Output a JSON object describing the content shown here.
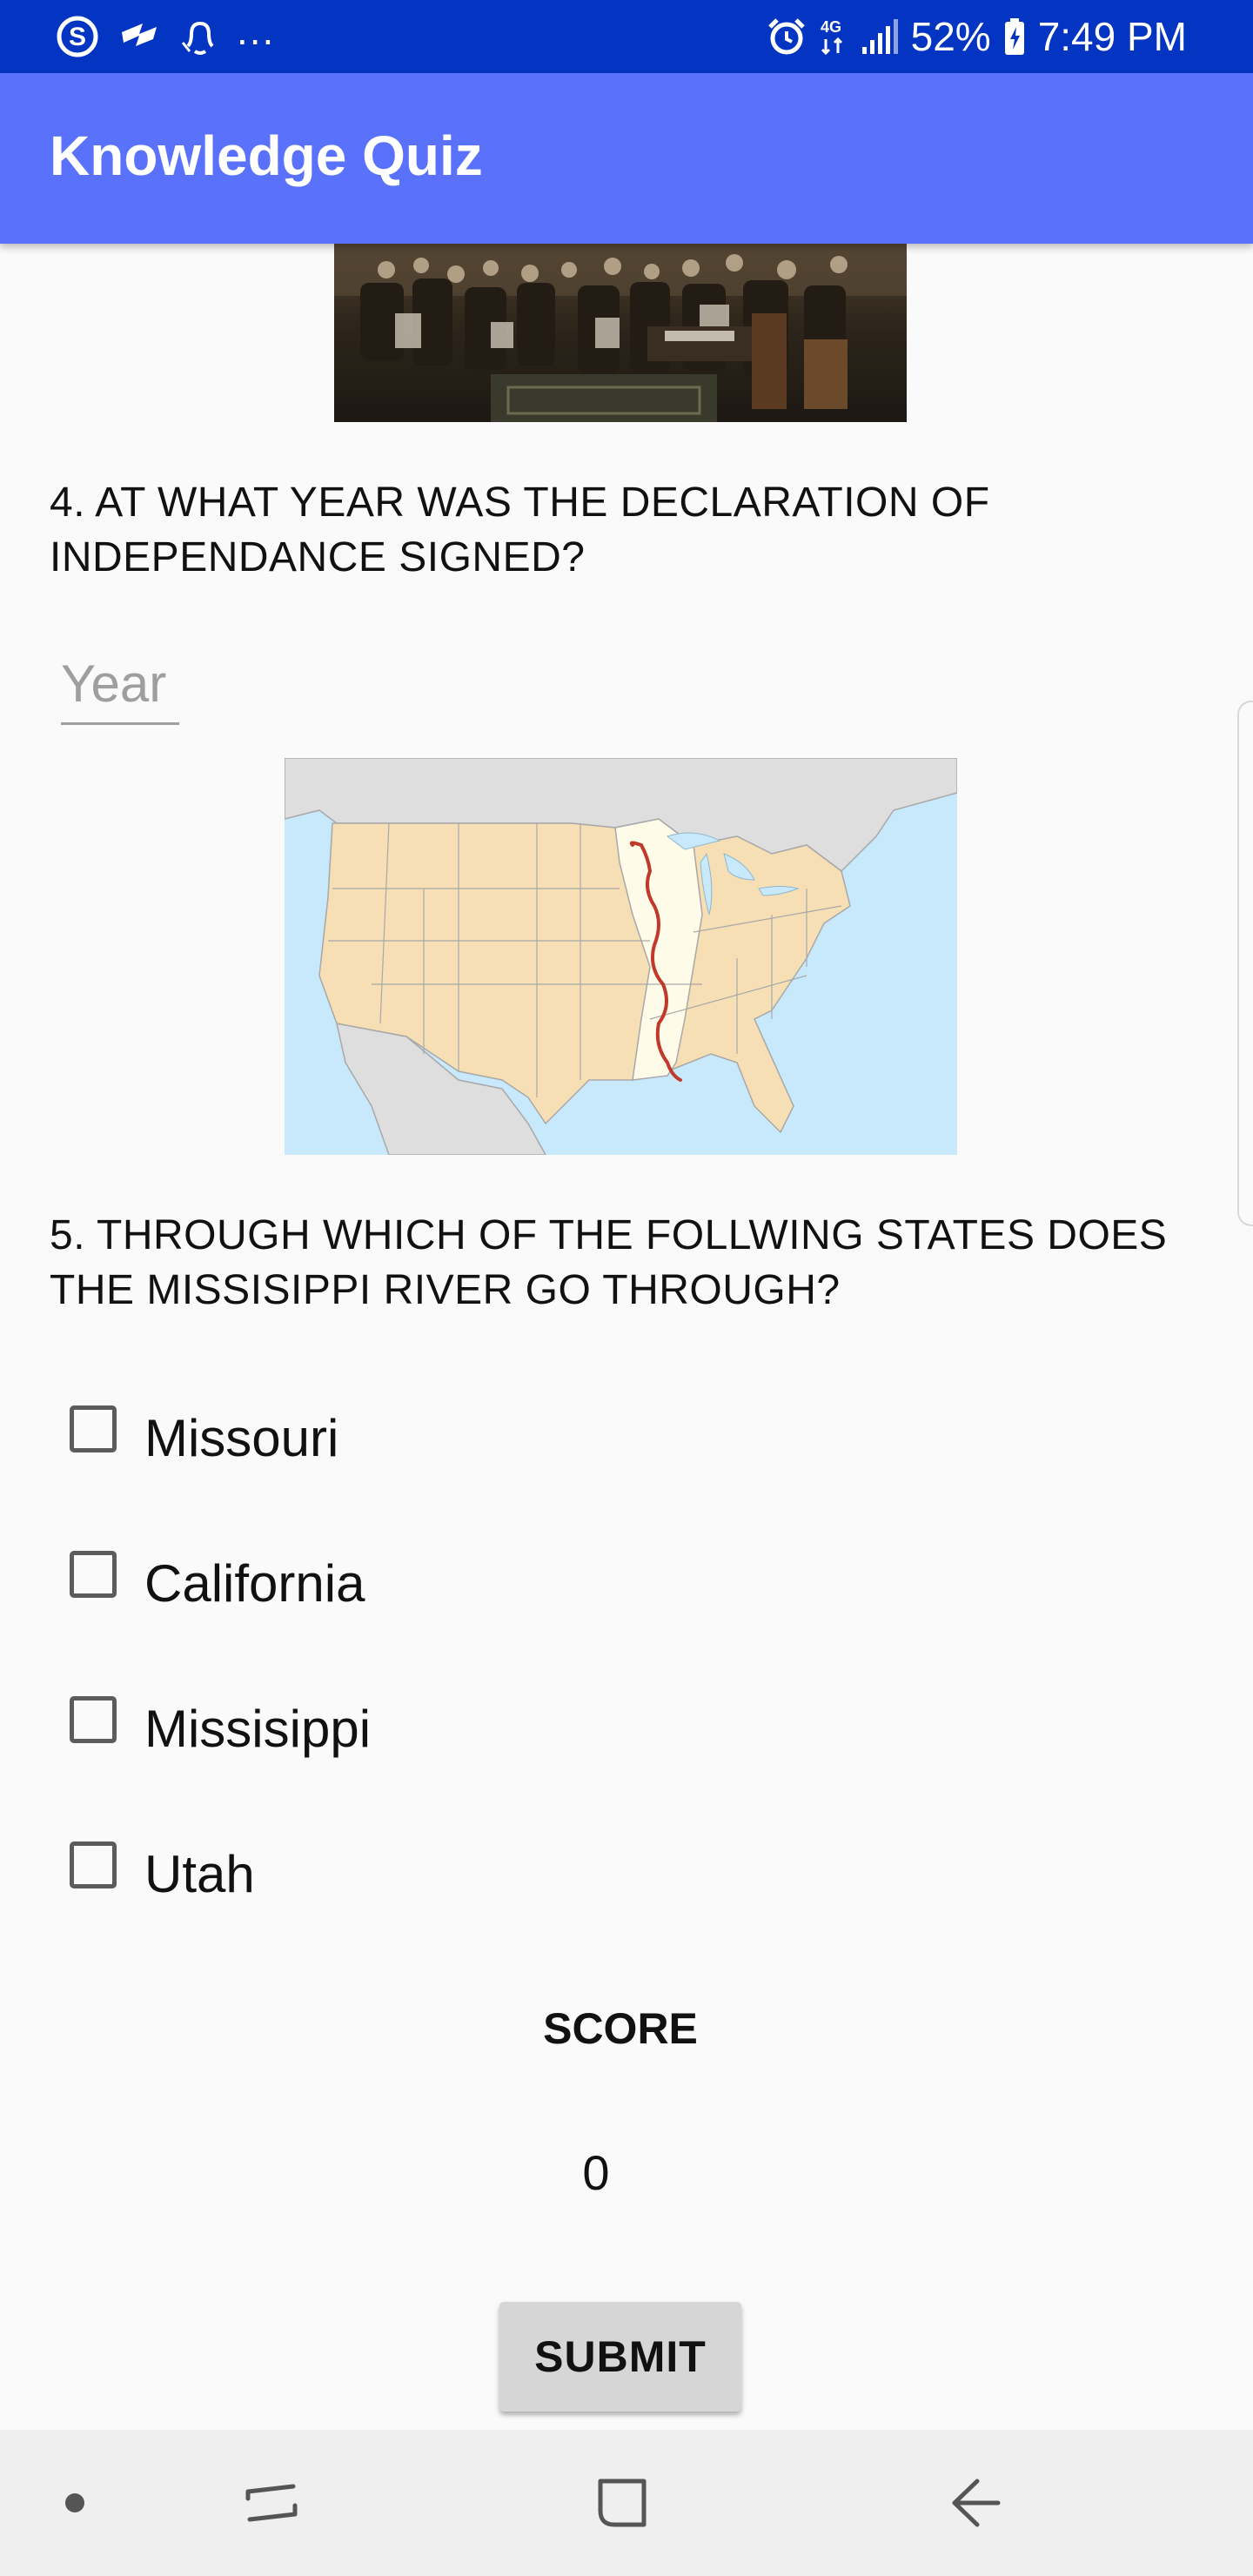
{
  "status_bar": {
    "left_icons": [
      "skype-icon",
      "cast-icon",
      "bell-icon"
    ],
    "overflow": "...",
    "right_icons": [
      "alarm-icon",
      "network-4g-icon",
      "signal-icon"
    ],
    "battery": "52%",
    "time": "7:49 PM"
  },
  "app_bar": {
    "title": "Knowledge Quiz",
    "color": "#5a72fb"
  },
  "question4": {
    "text": "4. AT WHAT YEAR WAS THE DECLARATION OF INDEPENDANCE SIGNED?",
    "input_placeholder": "Year",
    "input_value": ""
  },
  "question5": {
    "text": "5. THROUGH WHICH OF THE FOLLWING STATES DOES THE MISSISIPPI RIVER GO THROUGH?",
    "options": [
      {
        "label": "Missouri",
        "checked": false
      },
      {
        "label": "California",
        "checked": false
      },
      {
        "label": "Missisippi",
        "checked": false
      },
      {
        "label": "Utah",
        "checked": false
      }
    ]
  },
  "score": {
    "label": "SCORE",
    "value": "0"
  },
  "submit": {
    "label": "SUBMIT"
  },
  "nav_bar": {
    "icons": [
      "dot-icon",
      "recent-apps-icon",
      "home-icon",
      "back-icon"
    ]
  },
  "colors": {
    "status_bar": "#0334c2",
    "background": "#fafafa",
    "button": "#d6d6d6",
    "map_water": "#c8e9fb",
    "map_land": "#f6dfb4",
    "river": "#c0392b"
  }
}
